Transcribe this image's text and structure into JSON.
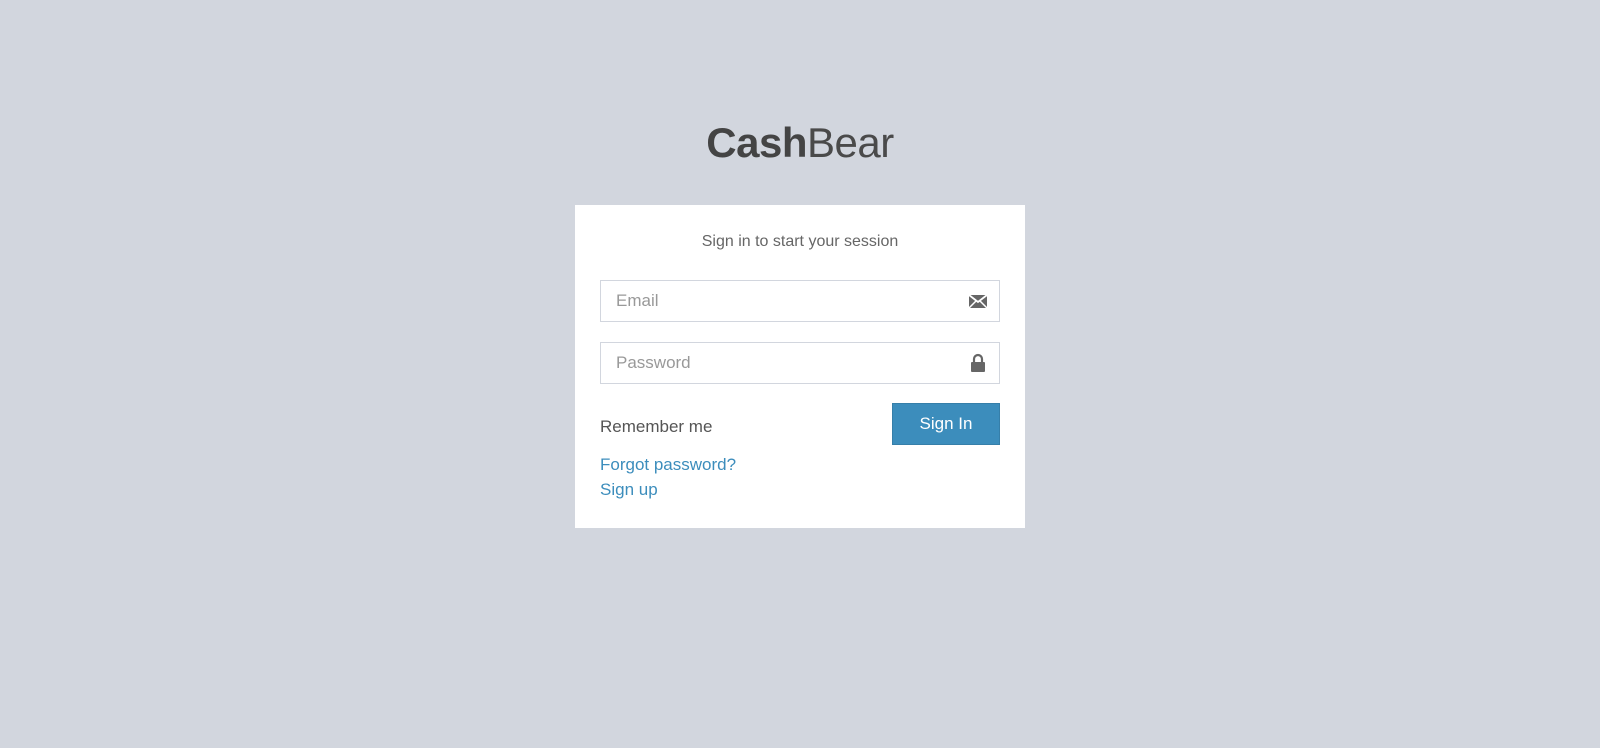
{
  "logo": {
    "bold": "Cash",
    "light": "Bear"
  },
  "login": {
    "message": "Sign in to start your session",
    "email_placeholder": "Email",
    "password_placeholder": "Password",
    "remember_label": "Remember me",
    "signin_label": "Sign In",
    "forgot_label": "Forgot password?",
    "signup_label": "Sign up"
  },
  "icons": {
    "email": "envelope-icon",
    "password": "lock-icon"
  },
  "colors": {
    "background": "#d2d6de",
    "primary": "#3c8dbc",
    "link": "#3c8dbc"
  }
}
